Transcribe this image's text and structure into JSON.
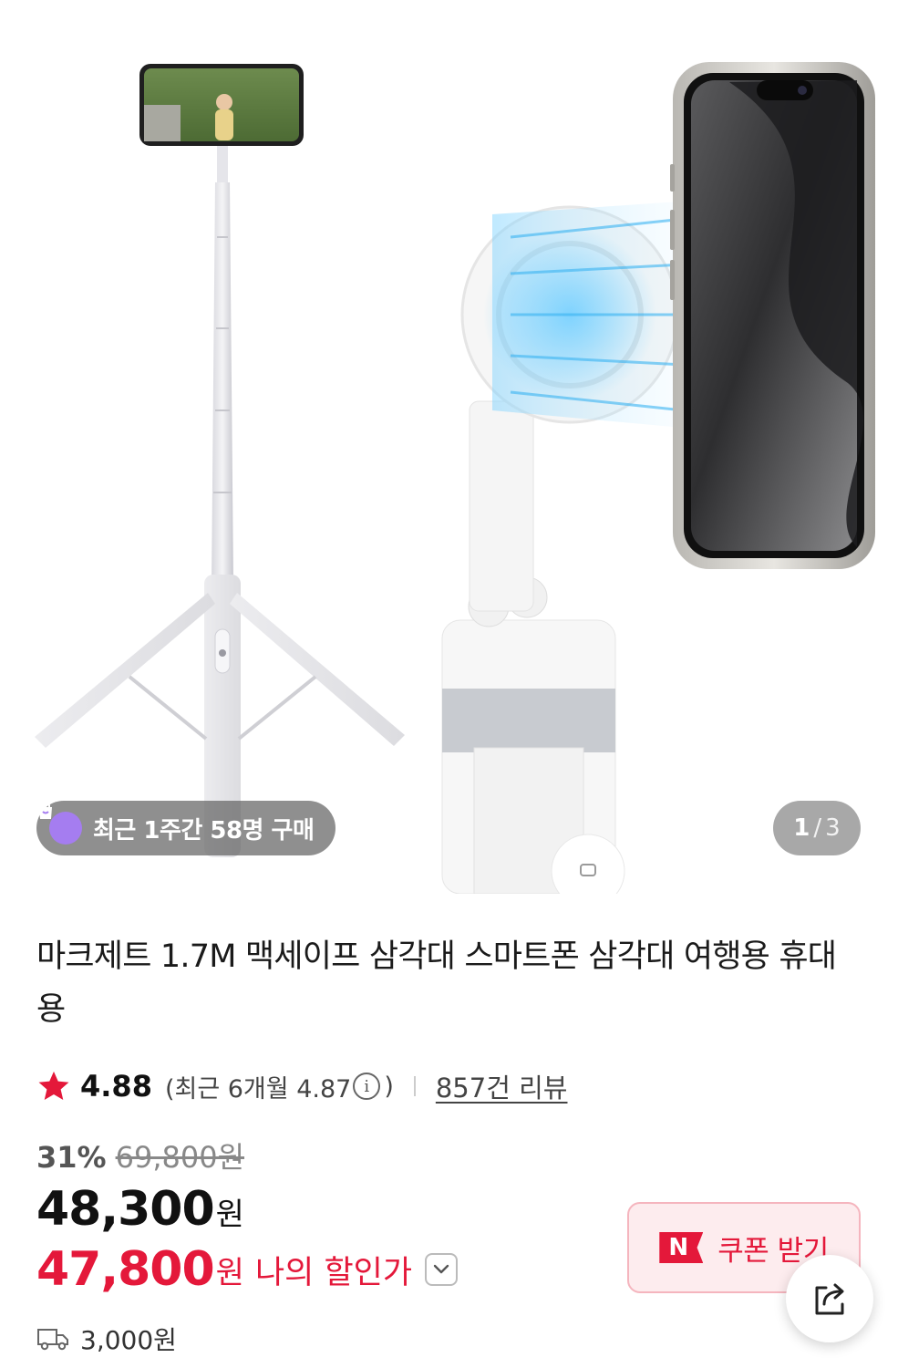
{
  "gallery": {
    "buyers_badge": "최근 1주간 58명 구매",
    "current_page": "1",
    "separator": "/",
    "total_pages": "3"
  },
  "product": {
    "title": "마크제트 1.7M 맥세이프 삼각대 스마트폰 삼각대 여행용 휴대용",
    "rating": "4.88",
    "recent_rating_prefix": "(최근 6개월 4.87",
    "recent_rating_suffix": ")",
    "review_count": "857건 리뷰",
    "discount_rate": "31%",
    "original_price": "69,800원",
    "price": "48,300",
    "price_unit": "원",
    "my_price": "47,800",
    "my_price_unit": "원",
    "my_price_label": "나의 할인가",
    "shipping_fee": "3,000원"
  },
  "coupon": {
    "logo": "N",
    "label": "쿠폰 받기"
  },
  "icons": {
    "star": "star-icon",
    "info": "info-icon",
    "chevron": "chevron-down-icon",
    "truck": "truck-icon",
    "share": "share-icon",
    "bag": "shopping-bag-icon"
  },
  "colors": {
    "accent_red": "#e4183a",
    "coupon_bg": "#fdecee",
    "badge_purple": "#a57df0"
  }
}
